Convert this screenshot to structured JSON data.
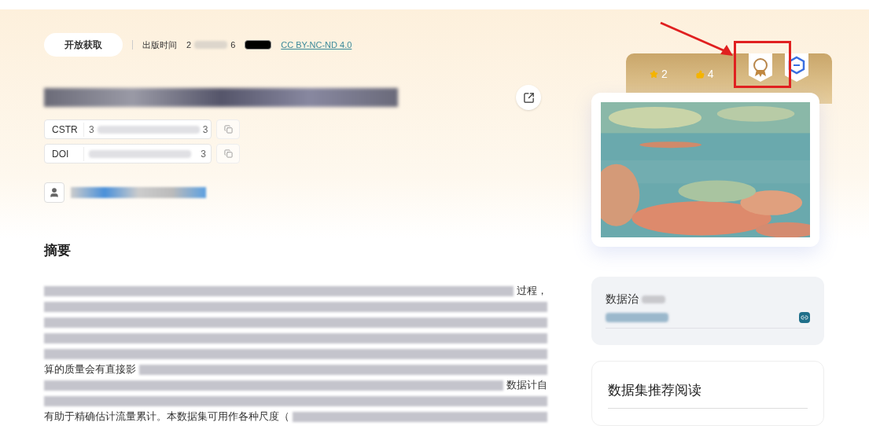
{
  "meta": {
    "access": "开放获取",
    "published_label": "出版时间",
    "published_start": "2",
    "published_end": "6",
    "license": "CC BY-NC-ND 4.0"
  },
  "identifiers": [
    {
      "label": "CSTR",
      "start": "3",
      "end": "3"
    },
    {
      "label": "DOI",
      "end": "3"
    }
  ],
  "abstract": {
    "heading": "摘要",
    "lines": [
      {
        "kind": "text",
        "tail": "过程，"
      },
      {
        "kind": "blurred"
      },
      {
        "kind": "blurred"
      },
      {
        "kind": "blurred"
      },
      {
        "kind": "blurred"
      },
      {
        "kind": "text",
        "lead": "算的质量会有直接影"
      },
      {
        "kind": "text",
        "tail": "数据计自"
      },
      {
        "kind": "blurred"
      },
      {
        "kind": "text",
        "lead": "有助于精确估计流量累计。本数据集可用作各种尺度（"
      }
    ]
  },
  "stats": {
    "stars": "2",
    "likes": "4"
  },
  "governance": {
    "title": "数据治"
  },
  "reading": {
    "title": "数据集推荐阅读"
  }
}
